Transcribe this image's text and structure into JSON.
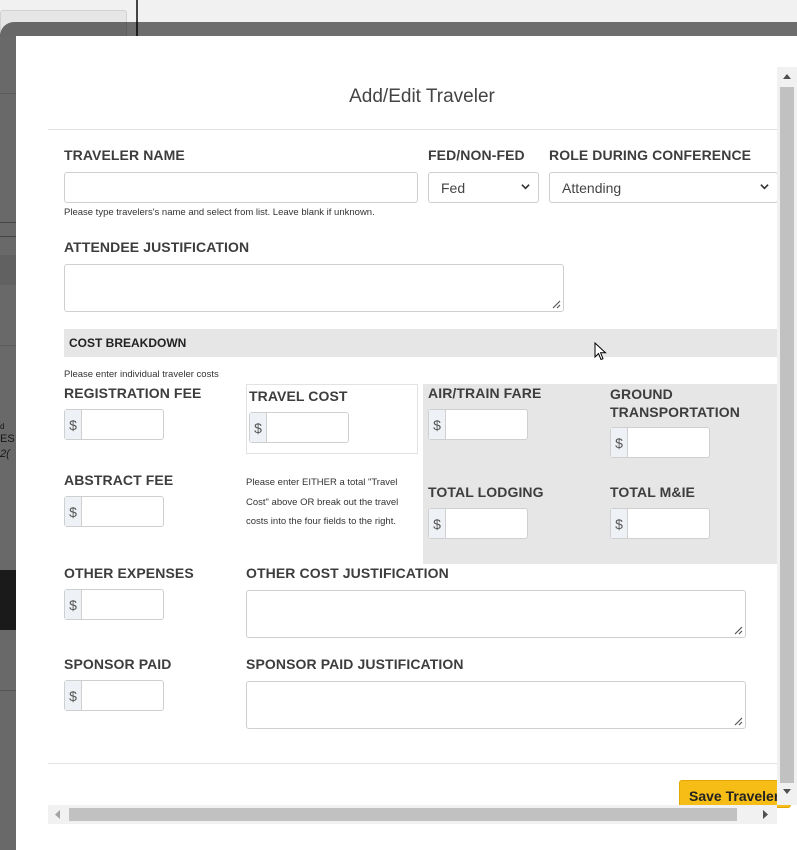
{
  "background": {
    "left_text": [
      "d",
      "ES",
      "2("
    ]
  },
  "modal": {
    "title": "Add/Edit Traveler"
  },
  "traveler_name": {
    "label": "TRAVELER NAME",
    "value": "",
    "hint": "Please type travelers's name and select from list. Leave blank if unknown."
  },
  "fed_nonfed": {
    "label": "FED/NON-FED",
    "selected": "Fed"
  },
  "role": {
    "label": "ROLE DURING CONFERENCE",
    "selected": "Attending"
  },
  "attendee_justification": {
    "label": "ATTENDEE JUSTIFICATION",
    "value": ""
  },
  "cost_breakdown": {
    "heading": "COST BREAKDOWN",
    "hint": "Please enter individual traveler costs",
    "currency_symbol": "$",
    "registration_fee": {
      "label": "REGISTRATION FEE",
      "value": ""
    },
    "travel_cost": {
      "label": "TRAVEL COST",
      "value": ""
    },
    "travel_note": "Please enter EITHER a total \"Travel Cost\" above OR break out the travel costs into the four fields to the right.",
    "air_train_fare": {
      "label": "AIR/TRAIN FARE",
      "value": ""
    },
    "ground_transportation": {
      "label_line1": "GROUND",
      "label_line2": "TRANSPORTATION",
      "value": ""
    },
    "abstract_fee": {
      "label": "ABSTRACT FEE",
      "value": ""
    },
    "total_lodging": {
      "label": "TOTAL LODGING",
      "value": ""
    },
    "total_mie": {
      "label": "TOTAL M&IE",
      "value": ""
    },
    "other_expenses": {
      "label": "OTHER EXPENSES",
      "value": ""
    },
    "other_cost_justification": {
      "label": "OTHER COST JUSTIFICATION",
      "value": ""
    },
    "sponsor_paid": {
      "label": "SPONSOR PAID",
      "value": ""
    },
    "sponsor_paid_justification": {
      "label": "SPONSOR PAID JUSTIFICATION",
      "value": ""
    }
  },
  "footer": {
    "save_label": "Save Traveler"
  },
  "colors": {
    "accent_button": "#f6bd16",
    "section_gray": "#e6e6e6"
  }
}
